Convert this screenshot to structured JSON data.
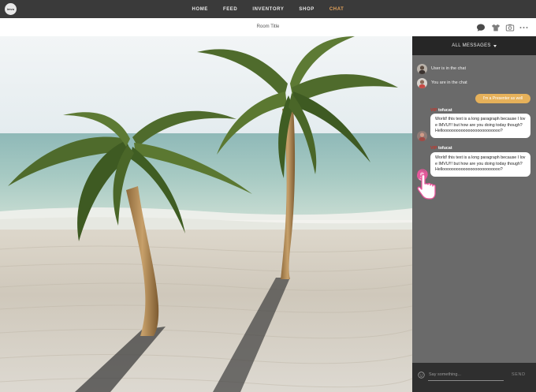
{
  "nav": {
    "logo_text": "imvu",
    "links": [
      {
        "label": "HOME",
        "active": false
      },
      {
        "label": "FEED",
        "active": false
      },
      {
        "label": "INVENTORY",
        "active": false
      },
      {
        "label": "SHOP",
        "active": false
      },
      {
        "label": "CHAT",
        "active": true
      }
    ],
    "accent_color": "#e3a25b"
  },
  "room": {
    "title": "Room Title",
    "toolbar_icons": [
      "chat-bubble-icon",
      "shirt-icon",
      "camera-icon",
      "more-icon"
    ]
  },
  "chat": {
    "filter_label": "ALL MESSAGES",
    "system_messages": [
      {
        "text": "User is in the chat"
      },
      {
        "text": "You are in the chat"
      }
    ],
    "presenter_message": "I'm a Presenter as well",
    "messages": [
      {
        "prefix": "VIP",
        "username": "tofucat",
        "text": "World! this text is a long paragraph because I love IMVU!!! but how are you doing today though? Hellooooooooooooooooooooooooo?"
      },
      {
        "prefix": "VIP",
        "username": "tofucat",
        "text": "World! this text is a long paragraph because I love IMVU!!! but how are you doing today though? Hellooooooooooooooooooooooooo?"
      }
    ],
    "input_placeholder": "Say something...",
    "send_label": "SEND",
    "username_prefix_color": "#c2372d",
    "presenter_bubble_color": "#e6b15a"
  }
}
